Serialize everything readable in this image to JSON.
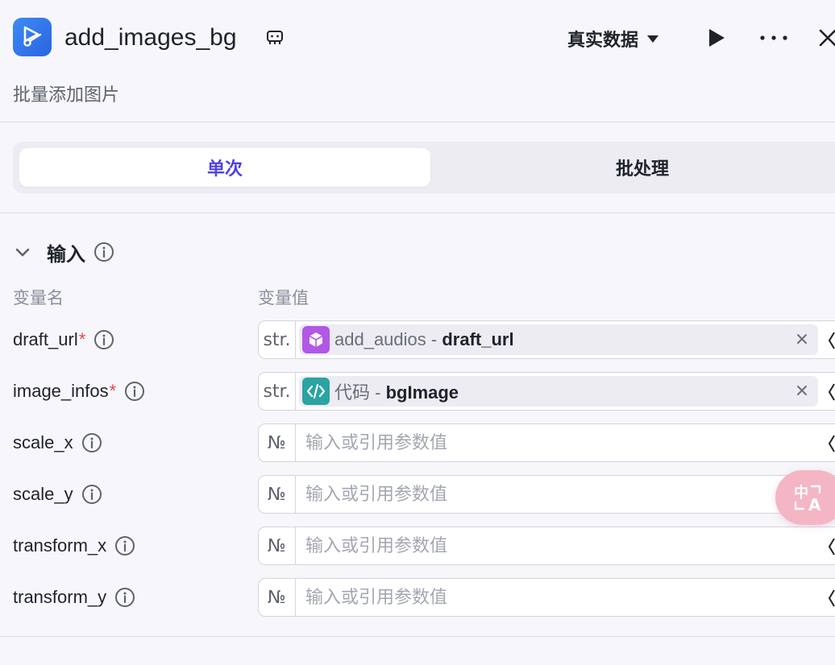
{
  "header": {
    "app_icon": "video-edit-icon",
    "title": "add_images_bg",
    "subtitle": "批量添加图片",
    "mode_label": "真实数据"
  },
  "tabs": [
    {
      "label": "单次",
      "active": true
    },
    {
      "label": "批处理",
      "active": false
    }
  ],
  "input_section": {
    "title": "输入",
    "col_name": "变量名",
    "col_value": "变量值",
    "rows": [
      {
        "name": "draft_url",
        "required": "*",
        "type": "str.",
        "ref_node": "add_audios",
        "ref_sep": " - ",
        "ref_var": "draft_url",
        "ref_icon": "cube-icon",
        "ref_color": "#b257e6"
      },
      {
        "name": "image_infos",
        "required": "*",
        "type": "str.",
        "ref_node": "代码",
        "ref_sep": " - ",
        "ref_var": "bgImage",
        "ref_icon": "code-icon",
        "ref_color": "#2aa3a3"
      },
      {
        "name": "scale_x",
        "type": "№",
        "placeholder": "输入或引用参数值"
      },
      {
        "name": "scale_y",
        "type": "№",
        "placeholder": "输入或引用参数值"
      },
      {
        "name": "transform_x",
        "type": "№",
        "placeholder": "输入或引用参数值"
      },
      {
        "name": "transform_y",
        "type": "№",
        "placeholder": "输入或引用参数值"
      }
    ]
  },
  "fab": {
    "label": "中A"
  },
  "colors": {
    "accent": "#4e40e5",
    "required": "#e5484d",
    "app_icon": "#2a63e0",
    "fab": "#f4b6c4"
  }
}
